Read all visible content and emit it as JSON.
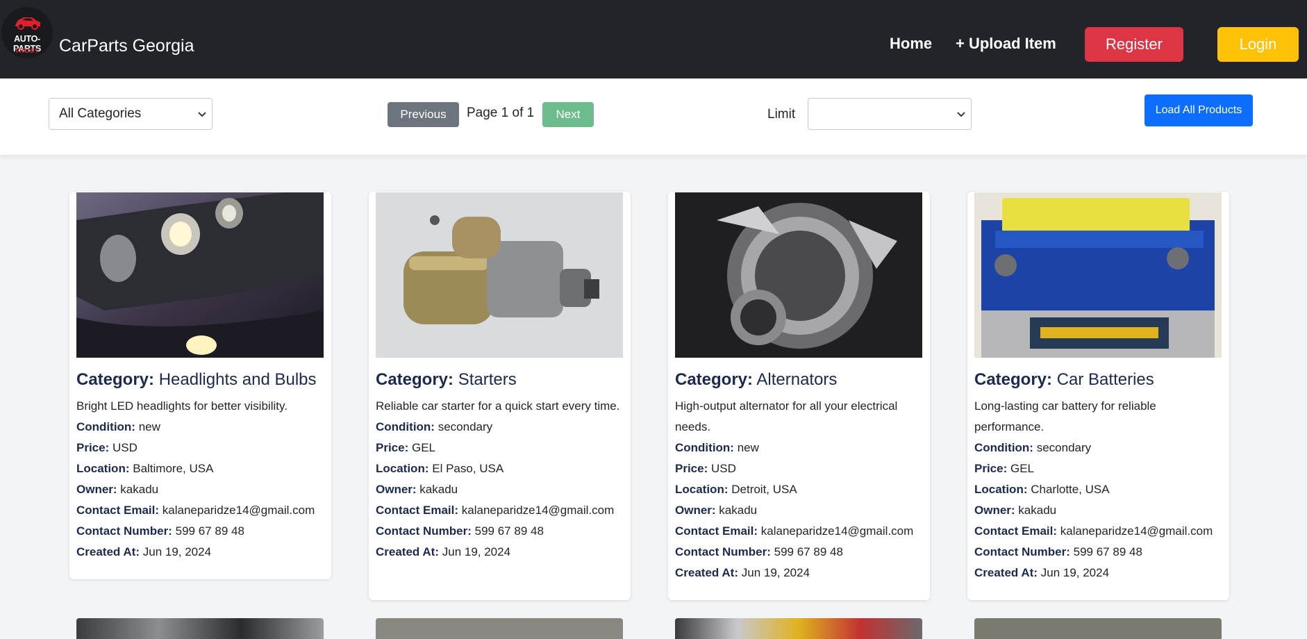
{
  "navbar": {
    "logo": {
      "line1": "AUTO-PARTS",
      "line2": "TRUST"
    },
    "brand": "CarParts Georgia",
    "links": {
      "home": "Home",
      "upload": "+ Upload Item"
    },
    "register": "Register",
    "login": "Login"
  },
  "controls": {
    "category_selected": "All Categories",
    "previous": "Previous",
    "page_info": "Page 1 of 1",
    "next": "Next",
    "limit_label": "Limit",
    "limit_selected": "",
    "load_all": "Load All Products"
  },
  "labels": {
    "category": "Category:",
    "condition": "Condition:",
    "price": "Price:",
    "location": "Location:",
    "owner": "Owner:",
    "contact_email": "Contact Email:",
    "contact_number": "Contact Number:",
    "created_at": "Created At:"
  },
  "products": [
    {
      "category": "Headlights and Bulbs",
      "description": "Bright LED headlights for better visibility.",
      "condition": "new",
      "price": "USD",
      "location": "Baltimore, USA",
      "owner": "kakadu",
      "contact_email": "kalaneparidze14@gmail.com",
      "contact_number": "599 67 89 48",
      "created_at": "Jun 19, 2024"
    },
    {
      "category": "Starters",
      "description": "Reliable car starter for a quick start every time.",
      "condition": "secondary",
      "price": "GEL",
      "location": "El Paso, USA",
      "owner": "kakadu",
      "contact_email": "kalaneparidze14@gmail.com",
      "contact_number": "599 67 89 48",
      "created_at": "Jun 19, 2024"
    },
    {
      "category": "Alternators",
      "description": "High-output alternator for all your electrical needs.",
      "condition": "new",
      "price": "USD",
      "location": "Detroit, USA",
      "owner": "kakadu",
      "contact_email": "kalaneparidze14@gmail.com",
      "contact_number": "599 67 89 48",
      "created_at": "Jun 19, 2024"
    },
    {
      "category": "Car Batteries",
      "description": "Long-lasting car battery for reliable performance.",
      "condition": "secondary",
      "price": "GEL",
      "location": "Charlotte, USA",
      "owner": "kakadu",
      "contact_email": "kalaneparidze14@gmail.com",
      "contact_number": "599 67 89 48",
      "created_at": "Jun 19, 2024"
    }
  ],
  "colors": {
    "navbar": "#212529",
    "register": "#dc3545",
    "login": "#ffc107",
    "previous": "#6c757d",
    "next": "#6dbd8c",
    "load_all": "#0d6efd",
    "title_text": "#1b2a4e"
  }
}
